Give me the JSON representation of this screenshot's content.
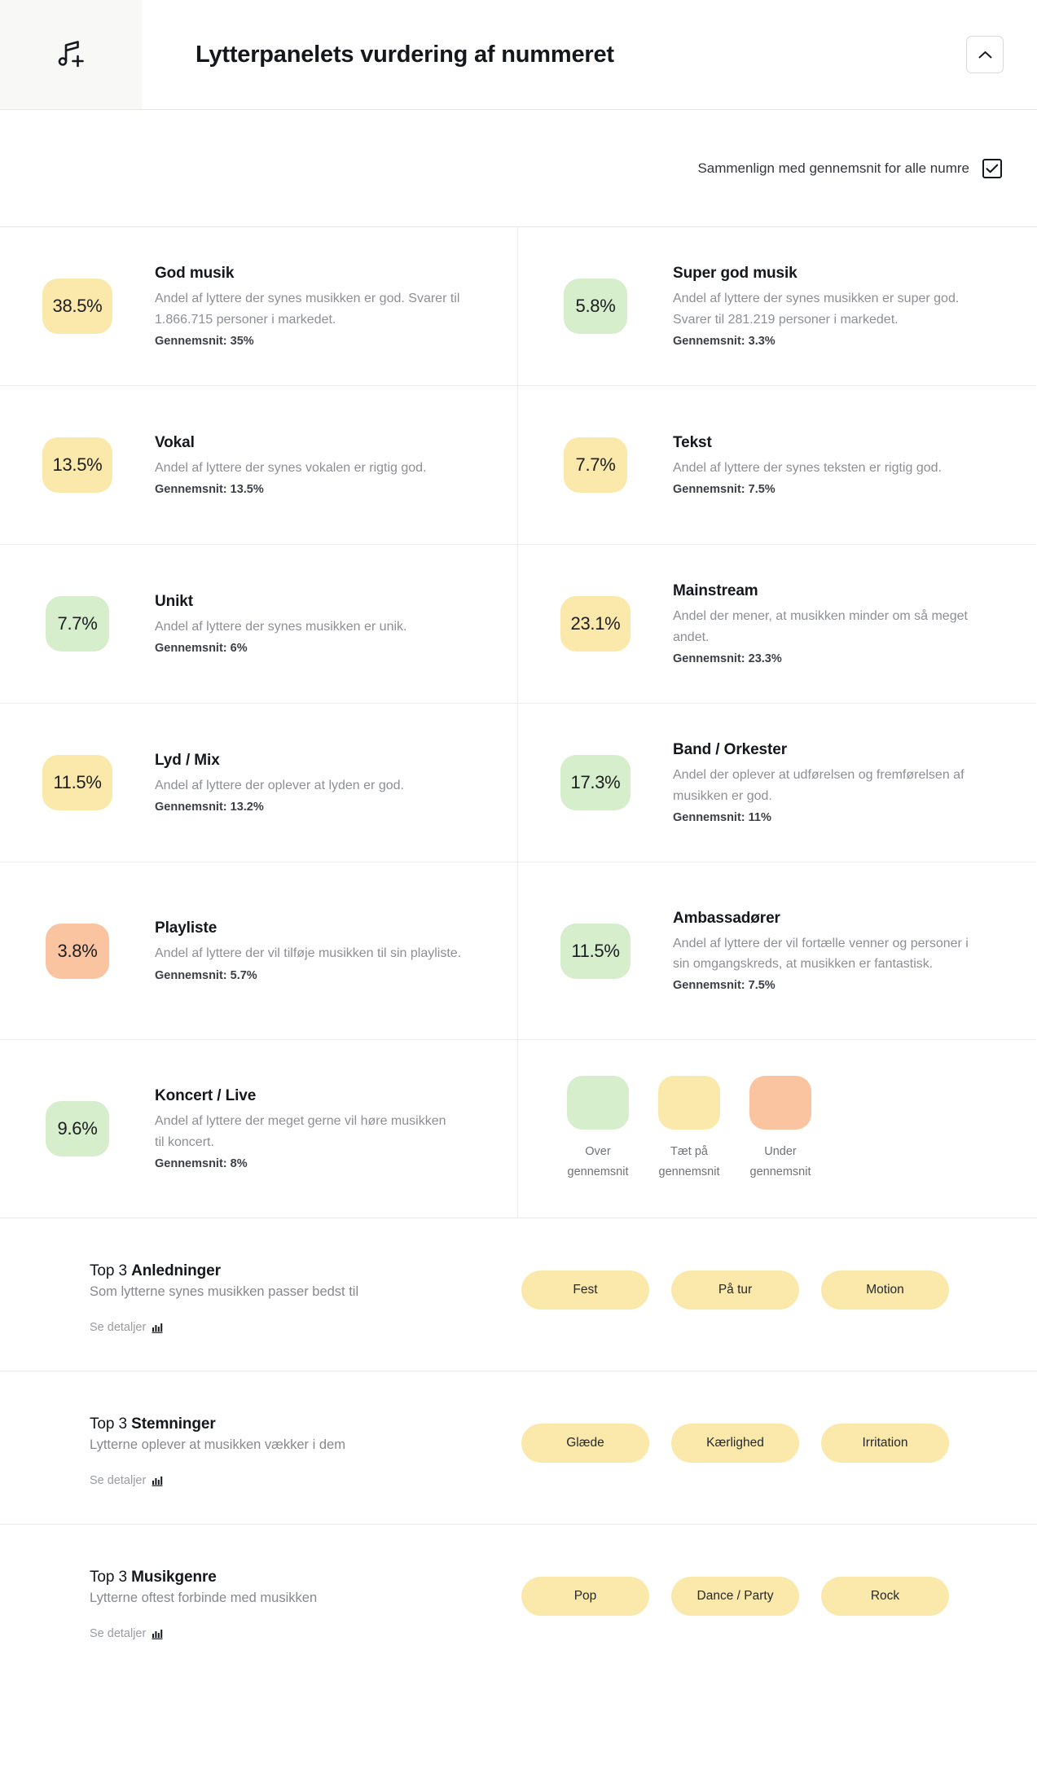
{
  "header": {
    "icon": "music-note-plus-icon",
    "title": "Lytterpanelets vurdering af nummeret",
    "collapse_icon": "chevron-up-icon"
  },
  "compare": {
    "label": "Sammenlign med gennemsnit for alle numre",
    "checked": true
  },
  "colors": {
    "above_average": "#d6eecb",
    "near_average": "#fbe9ac",
    "below_average": "#fbc4a0"
  },
  "metrics": [
    {
      "value": "38.5%",
      "level": "near",
      "title": "God musik",
      "desc": "Andel af lyttere der synes musikken er god. Svarer til 1.866.715 personer i markedet.",
      "avg": "Gennemsnit: 35%"
    },
    {
      "value": "5.8%",
      "level": "above",
      "title": "Super god musik",
      "desc": "Andel af lyttere der synes musikken er super god. Svarer til 281.219 personer i markedet.",
      "avg": "Gennemsnit: 3.3%"
    },
    {
      "value": "13.5%",
      "level": "near",
      "title": "Vokal",
      "desc": "Andel af lyttere der synes vokalen er rigtig god.",
      "avg": "Gennemsnit: 13.5%"
    },
    {
      "value": "7.7%",
      "level": "near",
      "title": "Tekst",
      "desc": "Andel af lyttere der synes teksten er rigtig god.",
      "avg": "Gennemsnit: 7.5%"
    },
    {
      "value": "7.7%",
      "level": "above",
      "title": "Unikt",
      "desc": "Andel af lyttere der synes musikken er unik.",
      "avg": "Gennemsnit: 6%"
    },
    {
      "value": "23.1%",
      "level": "near",
      "title": "Mainstream",
      "desc": "Andel der mener, at musikken minder om så meget andet.",
      "avg": "Gennemsnit: 23.3%"
    },
    {
      "value": "11.5%",
      "level": "near",
      "title": "Lyd / Mix",
      "desc": "Andel af lyttere der oplever at lyden er god.",
      "avg": "Gennemsnit: 13.2%"
    },
    {
      "value": "17.3%",
      "level": "above",
      "title": "Band / Orkester",
      "desc": "Andel der oplever at udførelsen og fremførelsen af musikken er god.",
      "avg": "Gennemsnit: 11%"
    },
    {
      "value": "3.8%",
      "level": "below",
      "title": "Playliste",
      "desc": "Andel af lyttere der vil tilføje musikken til sin playliste.",
      "avg": "Gennemsnit: 5.7%"
    },
    {
      "value": "11.5%",
      "level": "above",
      "title": "Ambassadører",
      "desc": "Andel af lyttere der vil fortælle venner og personer i sin omgangskreds, at musikken er fantastisk.",
      "avg": "Gennemsnit: 7.5%"
    },
    {
      "value": "9.6%",
      "level": "above",
      "title": "Koncert / Live",
      "desc": "Andel af lyttere der meget gerne vil høre musikken til koncert.",
      "avg": "Gennemsnit: 8%"
    }
  ],
  "legend": {
    "items": [
      {
        "level": "above",
        "line1": "Over",
        "line2": "gennemsnit"
      },
      {
        "level": "near",
        "line1": "Tæt på",
        "line2": "gennemsnit"
      },
      {
        "level": "below",
        "line1": "Under",
        "line2": "gennemsnit"
      }
    ]
  },
  "top3": [
    {
      "prefix": "Top 3 ",
      "name": "Anledninger",
      "sub": "Som lytterne synes musikken passer bedst til",
      "details_label": "Se detaljer",
      "details_icon": "bar-chart-icon",
      "pills": [
        "Fest",
        "På tur",
        "Motion"
      ]
    },
    {
      "prefix": "Top 3 ",
      "name": "Stemninger",
      "sub": "Lytterne oplever at musikken vækker i dem",
      "details_label": "Se detaljer",
      "details_icon": "bar-chart-icon",
      "pills": [
        "Glæde",
        "Kærlighed",
        "Irritation"
      ]
    },
    {
      "prefix": "Top 3 ",
      "name": "Musikgenre",
      "sub": "Lytterne oftest forbinde med musikken",
      "details_label": "Se detaljer",
      "details_icon": "bar-chart-icon",
      "pills": [
        "Pop",
        "Dance / Party",
        "Rock"
      ]
    }
  ]
}
